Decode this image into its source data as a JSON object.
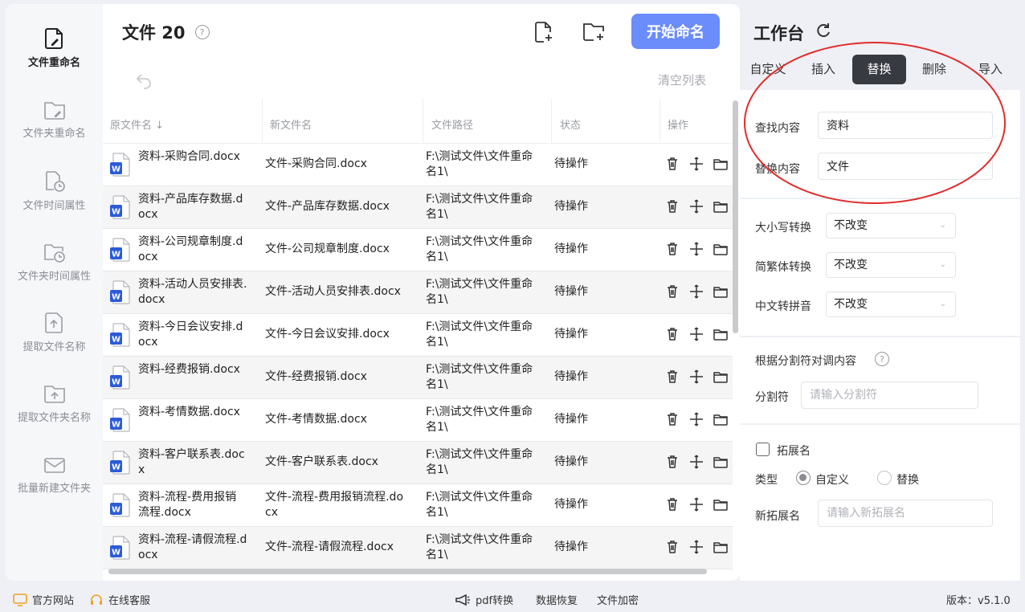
{
  "sidebar": {
    "items": [
      {
        "label": "文件重命名",
        "icon": "file-edit-icon",
        "active": true
      },
      {
        "label": "文件夹重命名",
        "icon": "folder-edit-icon"
      },
      {
        "label": "文件时间属性",
        "icon": "file-clock-icon"
      },
      {
        "label": "文件夹时间属性",
        "icon": "folder-clock-icon"
      },
      {
        "label": "提取文件名称",
        "icon": "file-upload-icon"
      },
      {
        "label": "提取文件夹名称",
        "icon": "folder-upload-icon"
      },
      {
        "label": "批量新建文件夹",
        "icon": "mail-folder-icon"
      }
    ]
  },
  "header": {
    "title": "文件 20",
    "help": "?",
    "start_button": "开始命名",
    "clear_list": "清空列表"
  },
  "table": {
    "columns": [
      "原文件名 ↓",
      "新文件名",
      "文件路径",
      "状态",
      "操作"
    ],
    "rows": [
      {
        "orig": "资料-采购合同.docx",
        "new": "文件-采购合同.docx",
        "path": "F:\\测试文件\\文件重命名1\\",
        "status": "待操作"
      },
      {
        "orig": "资料-产品库存数据.docx",
        "new": "文件-产品库存数据.docx",
        "path": "F:\\测试文件\\文件重命名1\\",
        "status": "待操作"
      },
      {
        "orig": "资料-公司规章制度.docx",
        "new": "文件-公司规章制度.docx",
        "path": "F:\\测试文件\\文件重命名1\\",
        "status": "待操作"
      },
      {
        "orig": "资料-活动人员安排表.docx",
        "new": "文件-活动人员安排表.docx",
        "path": "F:\\测试文件\\文件重命名1\\",
        "status": "待操作"
      },
      {
        "orig": "资料-今日会议安排.docx",
        "new": "文件-今日会议安排.docx",
        "path": "F:\\测试文件\\文件重命名1\\",
        "status": "待操作"
      },
      {
        "orig": "资料-经费报销.docx",
        "new": "文件-经费报销.docx",
        "path": "F:\\测试文件\\文件重命名1\\",
        "status": "待操作"
      },
      {
        "orig": "资料-考情数据.docx",
        "new": "文件-考情数据.docx",
        "path": "F:\\测试文件\\文件重命名1\\",
        "status": "待操作"
      },
      {
        "orig": "资料-客户联系表.docx",
        "new": "文件-客户联系表.docx",
        "path": "F:\\测试文件\\文件重命名1\\",
        "status": "待操作"
      },
      {
        "orig": "资料-流程-费用报销流程.docx",
        "new": "文件-流程-费用报销流程.docx",
        "path": "F:\\测试文件\\文件重命名1\\",
        "status": "待操作"
      },
      {
        "orig": "资料-流程-请假流程.docx",
        "new": "文件-流程-请假流程.docx",
        "path": "F:\\测试文件\\文件重命名1\\",
        "status": "待操作"
      }
    ]
  },
  "workbench": {
    "title": "工作台",
    "tabs": [
      "自定义",
      "插入",
      "替换",
      "删除",
      "导入"
    ],
    "active_tab": "替换",
    "find_label": "查找内容",
    "find_value": "资料",
    "replace_label": "替换内容",
    "replace_value": "文件",
    "case_label": "大小写转换",
    "case_value": "不改变",
    "trad_label": "简繁体转换",
    "trad_value": "不改变",
    "pinyin_label": "中文转拼音",
    "pinyin_value": "不改变",
    "split_title": "根据分割符对调内容",
    "split_label": "分割符",
    "split_placeholder": "请输入分割符",
    "ext_label": "拓展名",
    "type_label": "类型",
    "type_custom": "自定义",
    "type_replace": "替换",
    "new_ext_label": "新拓展名",
    "new_ext_placeholder": "请输入新拓展名"
  },
  "footer": {
    "website": "官方网站",
    "service": "在线客服",
    "pdf": "pdf转换",
    "recovery": "数据恢复",
    "encrypt": "文件加密",
    "version": "版本：v5.1.0"
  },
  "colors": {
    "accent": "#6b8cfb",
    "tab_active": "#373a40",
    "annotation": "#e02b2b",
    "word_blue": "#2b5bd7"
  }
}
